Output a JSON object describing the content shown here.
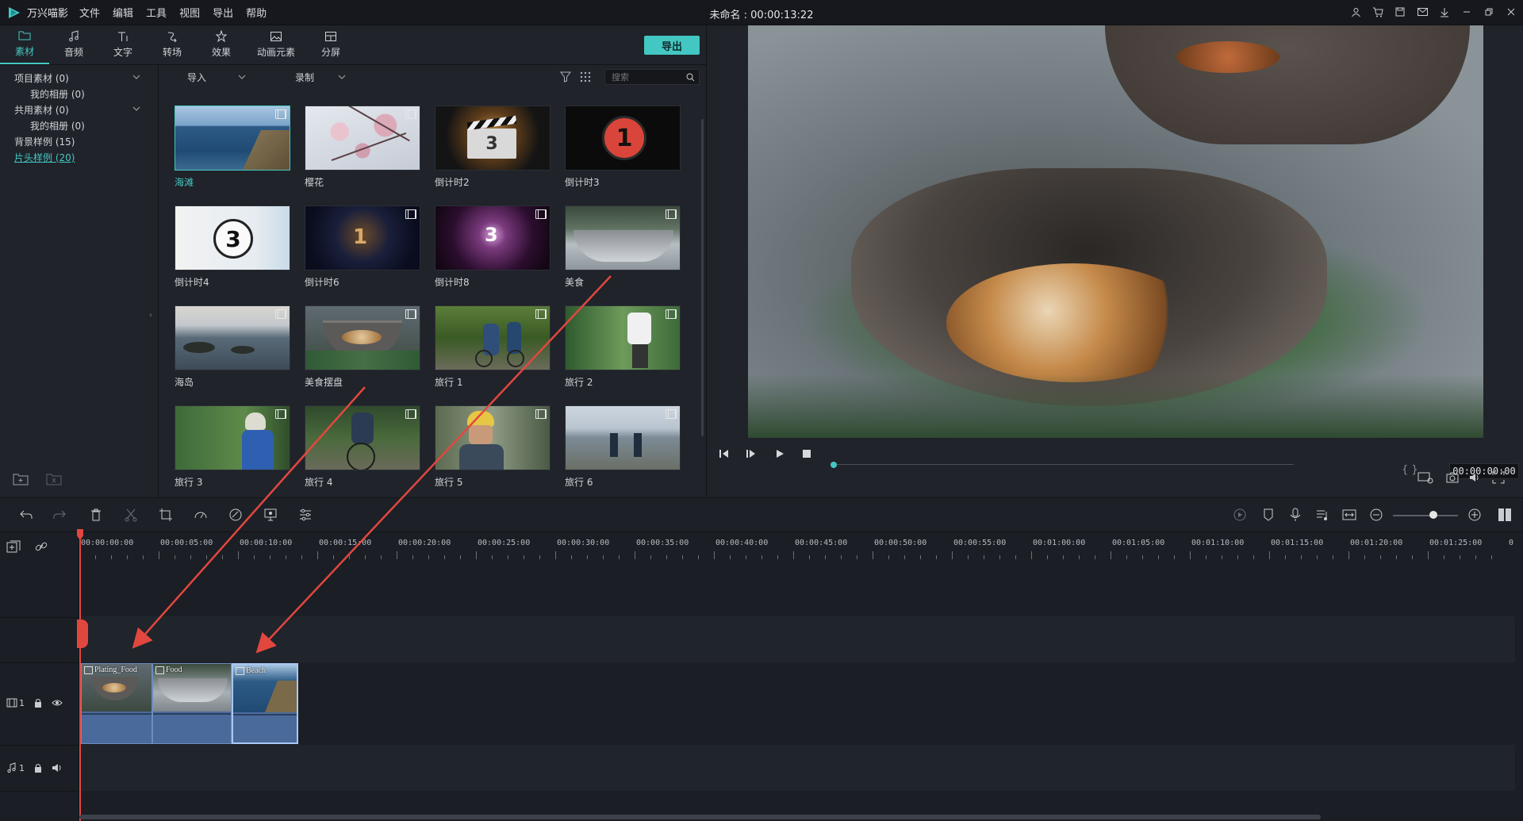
{
  "app": {
    "name": "万兴喵影",
    "doc_title": "未命名 : 00:00:13:22",
    "menu": [
      "文件",
      "编辑",
      "工具",
      "视图",
      "导出",
      "帮助"
    ]
  },
  "tabs": [
    {
      "label": "素材",
      "icon": "folder-icon"
    },
    {
      "label": "音频",
      "icon": "music-note-icon"
    },
    {
      "label": "文字",
      "icon": "text-icon"
    },
    {
      "label": "转场",
      "icon": "transition-icon"
    },
    {
      "label": "效果",
      "icon": "effects-icon"
    },
    {
      "label": "动画元素",
      "icon": "image-icon"
    },
    {
      "label": "分屏",
      "icon": "split-screen-icon"
    }
  ],
  "export_button": "导出",
  "sidebar": {
    "items": [
      {
        "label": "项目素材 (0)",
        "level": 0,
        "expandable": true
      },
      {
        "label": "我的相册 (0)",
        "level": 1
      },
      {
        "label": "共用素材 (0)",
        "level": 0,
        "expandable": true
      },
      {
        "label": "我的相册 (0)",
        "level": 1
      },
      {
        "label": "背景样例 (15)",
        "level": 0
      },
      {
        "label": "片头样例 (20)",
        "level": 0,
        "active": true
      }
    ]
  },
  "media_toolbar": {
    "import_label": "导入",
    "record_label": "录制",
    "search_placeholder": "搜索"
  },
  "media": [
    {
      "label": "海滩",
      "selected": true
    },
    {
      "label": "樱花"
    },
    {
      "label": "倒计时2"
    },
    {
      "label": "倒计时3"
    },
    {
      "label": "倒计时4"
    },
    {
      "label": "倒计时6"
    },
    {
      "label": "倒计时8"
    },
    {
      "label": "美食"
    },
    {
      "label": "海岛"
    },
    {
      "label": "美食摆盘"
    },
    {
      "label": "旅行 1"
    },
    {
      "label": "旅行 2"
    },
    {
      "label": "旅行 3"
    },
    {
      "label": "旅行 4"
    },
    {
      "label": "旅行 5"
    },
    {
      "label": "旅行 6"
    }
  ],
  "preview": {
    "timecode": "00:00:00:00",
    "braces": "{   }"
  },
  "timeline": {
    "ruler": [
      "00:00:00:00",
      "00:00:05:00",
      "00:00:10:00",
      "00:00:15:00",
      "00:00:20:00",
      "00:00:25:00",
      "00:00:30:00",
      "00:00:35:00",
      "00:00:40:00",
      "00:00:45:00",
      "00:00:50:00",
      "00:00:55:00",
      "00:01:00:00",
      "00:01:05:00",
      "00:01:10:00",
      "00:01:15:00",
      "00:01:20:00",
      "00:01:25:00",
      "0"
    ],
    "video_track_label": "1",
    "audio_track_label": "1",
    "clips": [
      {
        "label": "Plating_Food"
      },
      {
        "label": "Food"
      },
      {
        "label": "Beach",
        "selected": true
      }
    ]
  },
  "colors": {
    "accent": "#43c7c3",
    "playhead": "#e2473f",
    "clip": "#4a6a9b"
  }
}
